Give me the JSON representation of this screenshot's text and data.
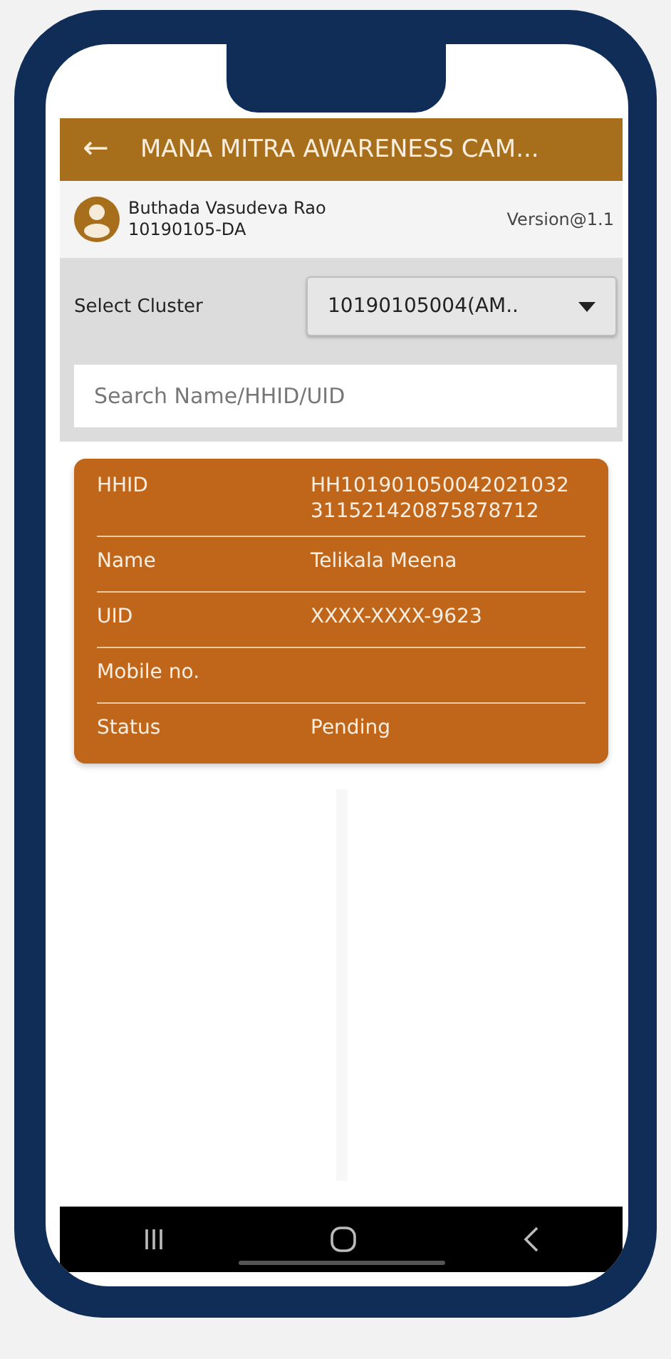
{
  "app_bar": {
    "back": "←",
    "title": "MANA MITRA AWARENESS CAM..."
  },
  "user": {
    "name": "Buthada Vasudeva Rao",
    "code": "10190105-DA",
    "version": "Version@1.1"
  },
  "cluster": {
    "label": "Select Cluster",
    "value": "10190105004(AM.."
  },
  "search": {
    "placeholder": "Search Name/HHID/UID"
  },
  "record": {
    "rows": [
      {
        "label": "HHID",
        "value": "HH101901050042021032 311521420875878712"
      },
      {
        "label": "Name",
        "value": "Telikala Meena"
      },
      {
        "label": "UID",
        "value": "XXXX-XXXX-9623"
      },
      {
        "label": "Mobile no."
      },
      {
        "label": "Status",
        "value": "Pending"
      }
    ]
  }
}
